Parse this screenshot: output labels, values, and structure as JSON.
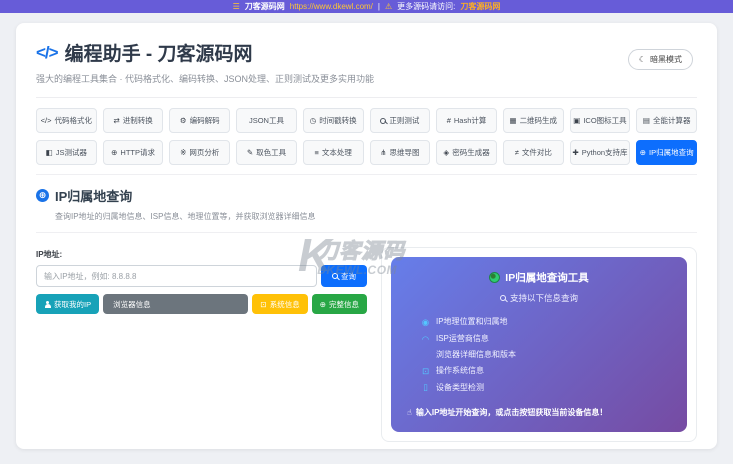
{
  "topbar": {
    "menu_icon": "☰",
    "site_name": "刀客源码网",
    "site_url": "https://www.dkewl.com/",
    "separator": "|",
    "bell_icon": "⚠",
    "notice_text": "更多源码请访问:",
    "notice_link": "刀客源码网"
  },
  "header": {
    "logo_icon": "</>",
    "title": "编程助手 - 刀客源码网",
    "subtitle": "强大的编程工具集合 · 代码格式化、编码转换、JSON处理、正则测试及更多实用功能",
    "dark_mode": {
      "icon": "☾",
      "label": "暗黑模式"
    }
  },
  "tabs": {
    "rows": [
      [
        {
          "name": "code-format",
          "icon": "</>",
          "label": "代码格式化"
        },
        {
          "name": "base-convert",
          "icon": "⇄",
          "label": "进制转换"
        },
        {
          "name": "encode-decode",
          "icon": "⚙",
          "label": "编码解码"
        },
        {
          "name": "json-tools",
          "icon": "",
          "label": "JSON工具"
        },
        {
          "name": "timestamp-convert",
          "icon": "◷",
          "label": "时间戳转换"
        },
        {
          "name": "regex-test",
          "icon": "mag",
          "label": "正则测试"
        },
        {
          "name": "hash-calc",
          "icon": "#",
          "label": "Hash计算"
        },
        {
          "name": "qrcode-generate",
          "icon": "▦",
          "label": "二维码生成"
        },
        {
          "name": "ico-tool",
          "icon": "▣",
          "label": "ICO图标工具"
        },
        {
          "name": "calculator",
          "icon": "▤",
          "label": "全能计算器"
        }
      ],
      [
        {
          "name": "js-tester",
          "icon": "◧",
          "label": "JS测试器"
        },
        {
          "name": "http-request",
          "icon": "⊕",
          "label": "HTTP请求"
        },
        {
          "name": "page-analysis",
          "icon": "※",
          "label": "网页分析"
        },
        {
          "name": "color-picker",
          "icon": "✎",
          "label": "取色工具"
        },
        {
          "name": "text-process",
          "icon": "≡",
          "label": "文本处理"
        },
        {
          "name": "mind-map",
          "icon": "⋔",
          "label": "思维导图"
        },
        {
          "name": "password-generator",
          "icon": "◈",
          "label": "密码生成器"
        },
        {
          "name": "file-diff",
          "icon": "≠",
          "label": "文件对比"
        },
        {
          "name": "python-library",
          "icon": "✚",
          "label": "Python支持库"
        },
        {
          "name": "ip-lookup",
          "icon": "⊕",
          "label": "IP归属地查询",
          "active": true
        }
      ]
    ]
  },
  "tool": {
    "globe_icon": "⊕",
    "title": "IP归属地查询",
    "subtitle": "查询IP地址的归属地信息、ISP信息、地理位置等，并获取浏览器详细信息",
    "form": {
      "ip_label": "IP地址:",
      "ip_placeholder": "输入IP地址，例如: 8.8.8.8",
      "query_button": "查询",
      "my_ip_button": "获取我的IP",
      "browser_button": "浏览器信息",
      "system_icon": "⊡",
      "system_button": "系统信息",
      "full_icon": "⊕",
      "full_button": "完整信息"
    },
    "panel": {
      "title": "IP归属地查询工具",
      "subtitle": "支持以下信息查询",
      "features": [
        {
          "name": "location",
          "icon": "◉",
          "label": "IP地理位置和归属地"
        },
        {
          "name": "isp",
          "icon": "◠",
          "label": "ISP运营商信息"
        },
        {
          "name": "browser",
          "icon": "",
          "label": "浏览器详细信息和版本"
        },
        {
          "name": "os",
          "icon": "⊡",
          "label": "操作系统信息"
        },
        {
          "name": "device",
          "icon": "▯",
          "label": "设备类型检测"
        }
      ],
      "footer_icon": "☝",
      "footer": "输入IP地址开始查询，或点击按钮获取当前设备信息！"
    }
  },
  "watermark": {
    "logo": "K",
    "text": "刀客源码",
    "domain": "DKEWL.COM"
  },
  "colors": {
    "topbar": "#675cd8",
    "primary": "#0d6efd",
    "teal": "#17a2b8",
    "grey": "#6c757d",
    "yellow": "#ffc107",
    "green": "#28a745",
    "panel_gradient_start": "#667eea",
    "panel_gradient_end": "#764ba2"
  }
}
